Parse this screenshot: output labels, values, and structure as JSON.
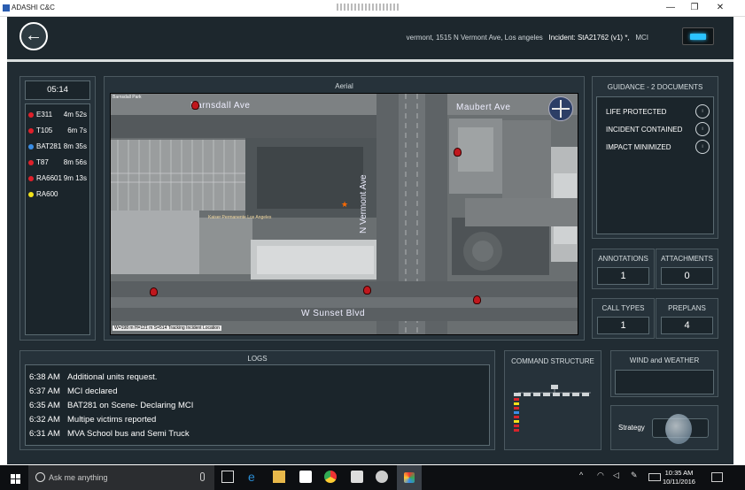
{
  "window": {
    "title": "ADASHI C&C",
    "min": "—",
    "max": "❐",
    "close": "✕"
  },
  "header": {
    "location": "vermont, 1515 N Vermont Ave, Los angeles",
    "incident_label": "Incident: StA21762 (v1) *,",
    "incident_type": "MCI",
    "status_color": "#2bc3ff"
  },
  "timer": "05:14",
  "units": [
    {
      "name": "E311",
      "time": "4m 52s",
      "color": "#e0202a"
    },
    {
      "name": "T105",
      "time": "6m 7s",
      "color": "#e0202a"
    },
    {
      "name": "BAT281",
      "time": "8m 35s",
      "color": "#3a8ee6"
    },
    {
      "name": "T87",
      "time": "8m 56s",
      "color": "#e0202a"
    },
    {
      "name": "RA6601",
      "time": "9m 13s",
      "color": "#e0202a"
    },
    {
      "name": "RA600",
      "time": "",
      "color": "#f2e21a"
    }
  ],
  "aerial": {
    "title": "Aerial",
    "streets": {
      "barnsdall": "Barnsdall Ave",
      "maubert": "Maubert Ave",
      "vermont": "N Vermont Ave",
      "sunset": "W Sunset Blvd"
    },
    "park_label": "Barnsdall Park",
    "business_label": "Kaiser Permanente Los Angeles",
    "info": {
      "width": "W=198 m",
      "height": "H=121 m",
      "scale": "S=514",
      "mode": "Tracking Incident Location"
    }
  },
  "guidance": {
    "title": "GUIDANCE - 2 DOCUMENTS",
    "items": [
      "LIFE PROTECTED",
      "INCIDENT CONTAINED",
      "IMPACT MINIMIZED"
    ]
  },
  "counters": [
    {
      "label": "ANNOTATIONS",
      "value": "1"
    },
    {
      "label": "ATTACHMENTS",
      "value": "0"
    },
    {
      "label": "CALL TYPES",
      "value": "1"
    },
    {
      "label": "PREPLANS",
      "value": "4"
    }
  ],
  "logs": {
    "title": "LOGS",
    "entries": [
      {
        "time": "6:38 AM",
        "text": "Additional units request."
      },
      {
        "time": "6:37 AM",
        "text": "MCI declared"
      },
      {
        "time": "6:35 AM",
        "text": "BAT281 on Scene- Declaring MCI"
      },
      {
        "time": "6:32 AM",
        "text": "Multipe victims reported"
      },
      {
        "time": "6:31 AM",
        "text": "MVA School bus and Semi Truck"
      }
    ]
  },
  "command": {
    "title": "COMMAND STRUCTURE"
  },
  "wind": {
    "title": "WIND and WEATHER"
  },
  "strategy": {
    "label": "Strategy"
  },
  "taskbar": {
    "search_placeholder": "Ask me anything",
    "time": "10:35 AM",
    "date": "10/11/2016"
  }
}
